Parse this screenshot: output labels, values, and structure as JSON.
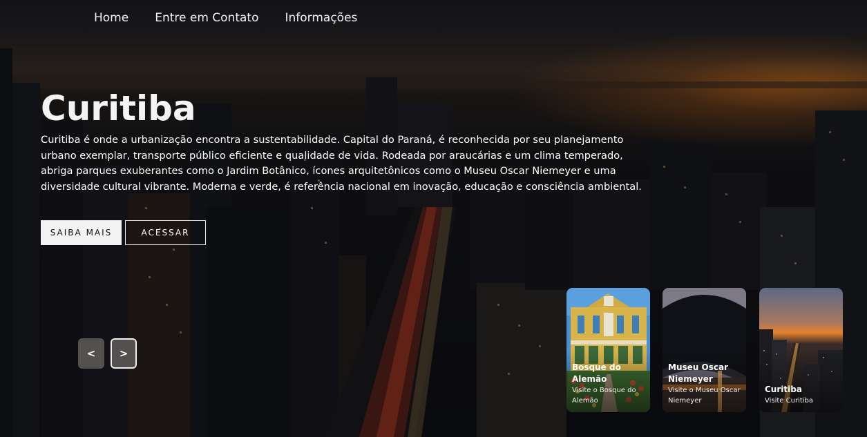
{
  "nav": {
    "items": [
      {
        "label": "Home"
      },
      {
        "label": "Entre em Contato"
      },
      {
        "label": "Informações"
      }
    ]
  },
  "hero": {
    "title": "Curitiba",
    "description": "Curitiba é onde a urbanização encontra a sustentabilidade. Capital do Paraná, é reconhecida por seu planejamento urbano exemplar, transporte público eficiente e qualidade de vida. Rodeada por araucárias e um clima temperado, abriga parques exuberantes como o Jardim Botânico, ícones arquitetônicos como o Museu Oscar Niemeyer e uma diversidade cultural vibrante. Moderna e verde, é referência nacional em inovação, educação e consciência ambiental.",
    "primary_button": "SAIBA MAIS",
    "secondary_button": "ACESSAR"
  },
  "slider": {
    "prev_label": "<",
    "next_label": ">"
  },
  "cards": [
    {
      "title": "Bosque do Alemão",
      "subtitle": "Visite o Bosque do Alemão"
    },
    {
      "title": "Museu Oscar Niemeyer",
      "subtitle": "Visite o Museu Oscar Niemeyer"
    },
    {
      "title": "Curitiba",
      "subtitle": "Visite Curitiba"
    }
  ],
  "colors": {
    "button_primary_bg": "#f3f3f3",
    "arrow_bg": "#54504f",
    "sunset_accent": "#d66e1e"
  }
}
